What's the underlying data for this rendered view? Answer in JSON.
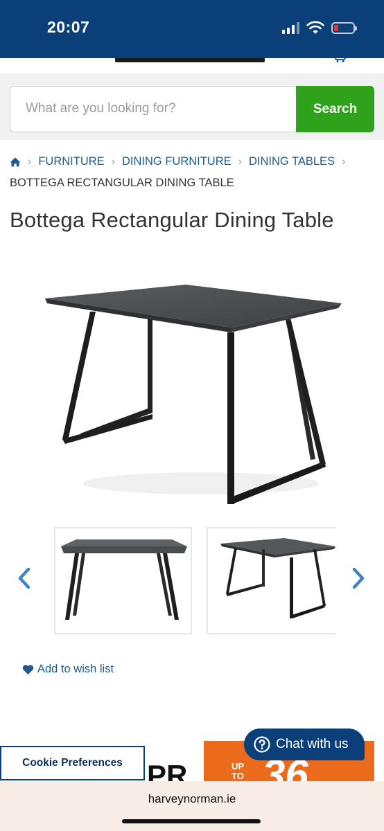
{
  "status_bar": {
    "time": "20:07",
    "bg_color": "#0b3f7a",
    "battery_color": "#e8332f",
    "icons": [
      "signal-icon",
      "wifi-icon",
      "battery-icon"
    ]
  },
  "search": {
    "placeholder": "What are you looking for?",
    "button_label": "Search",
    "button_color": "#2fa21b"
  },
  "breadcrumb": {
    "home_icon": "home-icon",
    "items": [
      "FURNITURE",
      "DINING FURNITURE",
      "DINING TABLES"
    ],
    "current": "BOTTEGA RECTANGULAR DINING TABLE"
  },
  "product": {
    "title": "Bottega Rectangular Dining Table",
    "wishlist_label": "Add to wish list",
    "thumbnails_visible": 2
  },
  "promo": {
    "big_text": "PR",
    "small_text_1": "UP",
    "small_text_2": "TO",
    "number_fragment": "36",
    "color": "#ec6a1c"
  },
  "cookie": {
    "label": "Cookie Preferences"
  },
  "chat": {
    "label": "Chat with us"
  },
  "browser": {
    "domain": "harveynorman.ie"
  },
  "colors": {
    "link": "#1d5b8f",
    "brand_navy": "#0b3f7a"
  }
}
